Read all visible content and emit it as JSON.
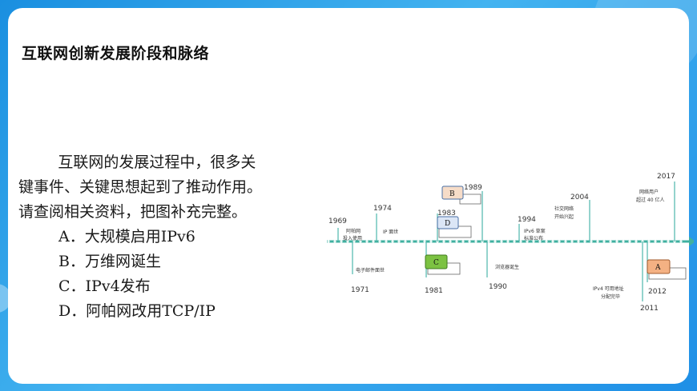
{
  "slide": {
    "title": "互联网创新发展阶段和脉络",
    "paragraph_line1": "互联网的发展过程中，很多关",
    "paragraph_line2": "键事件、关键思想起到了推动作用。",
    "paragraph_line3": "请查阅相关资料，把图补充完整。",
    "options": [
      {
        "letter": "A．",
        "text": "大规模启用IPv6"
      },
      {
        "letter": "B．",
        "text": "万维网诞生"
      },
      {
        "letter": "C．",
        "text": "IPv4发布"
      },
      {
        "letter": "D．",
        "text": "阿帕网改用TCP/IP"
      }
    ]
  },
  "timeline": {
    "colors": {
      "axis": "#3fb0a0",
      "box_b": "#f6dcc8",
      "box_d": "#dbe6f6",
      "box_c": "#7cc242",
      "box_a": "#f4b183"
    },
    "events": [
      {
        "year": "1969",
        "desc1": "阿帕网",
        "desc2": "投入使用"
      },
      {
        "year": "1974",
        "desc1": "IP 面世"
      },
      {
        "year": "1971",
        "desc1": "电子邮件面世"
      },
      {
        "year": "1983",
        "box": "D"
      },
      {
        "year": "1989",
        "box": "B"
      },
      {
        "year": "1981",
        "box": "C"
      },
      {
        "year": "1990",
        "desc1": "浏览器诞生"
      },
      {
        "year": "1994",
        "desc1": "IPv6 草案",
        "desc2": "标准公布"
      },
      {
        "year": "2004",
        "desc1": "社交网络",
        "desc2": "开始兴起"
      },
      {
        "year": "2017",
        "desc1": "网络用户",
        "desc2": "超过 40 亿人"
      },
      {
        "year": "2011",
        "desc1": "IPv4 可用地址",
        "desc2": "分配完毕"
      },
      {
        "year": "2012",
        "box": "A"
      }
    ]
  }
}
